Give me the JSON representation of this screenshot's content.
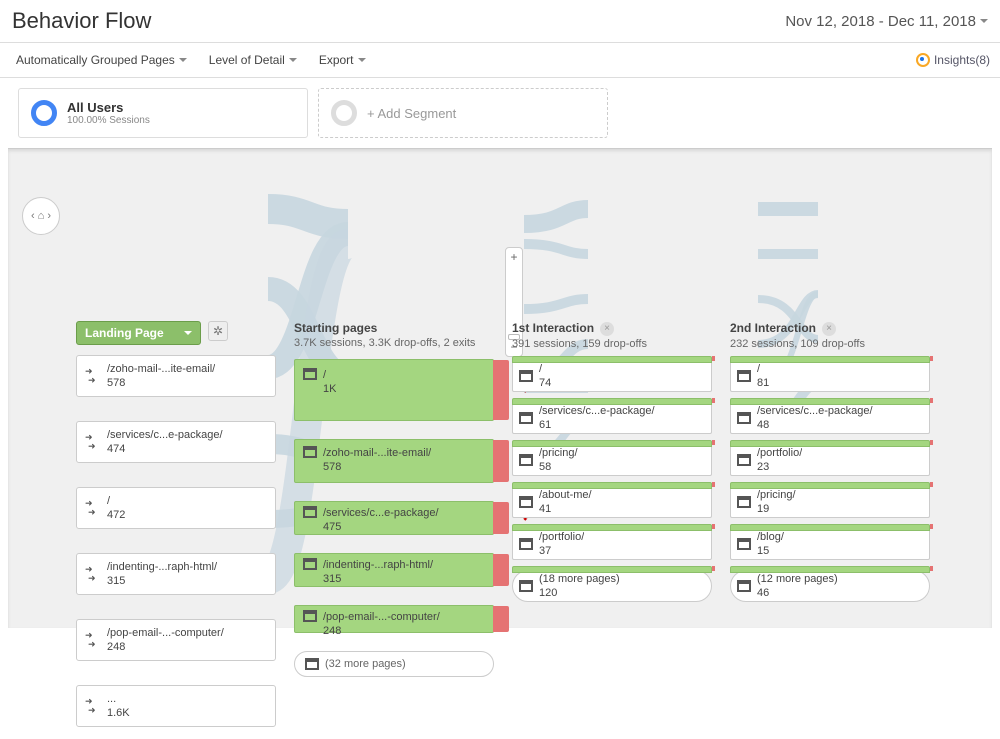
{
  "header": {
    "title": "Behavior Flow",
    "date_range": "Nov 12, 2018 - Dec 11, 2018"
  },
  "toolbar": {
    "grouping": "Automatically Grouped Pages",
    "detail": "Level of Detail",
    "export": "Export",
    "insights": "Insights(8)"
  },
  "segments": {
    "all_users_title": "All Users",
    "all_users_sub": "100.00% Sessions",
    "add_segment": "+ Add Segment"
  },
  "columns": [
    {
      "title": "Landing Page",
      "type": "landing",
      "nodes": [
        {
          "label": "/zoho-mail-...ite-email/",
          "value": "578"
        },
        {
          "label": "/services/c...e-package/",
          "value": "474"
        },
        {
          "label": "/",
          "value": "472"
        },
        {
          "label": "/indenting-...raph-html/",
          "value": "315"
        },
        {
          "label": "/pop-email-...-computer/",
          "value": "248"
        },
        {
          "label": "...",
          "value": "1.6K"
        }
      ]
    },
    {
      "title": "Starting pages",
      "sub": "3.7K sessions, 3.3K drop-offs, 2 exits",
      "type": "start",
      "nodes": [
        {
          "label": "/",
          "value": "1K"
        },
        {
          "label": "/zoho-mail-...ite-email/",
          "value": "578"
        },
        {
          "label": "/services/c...e-package/",
          "value": "475"
        },
        {
          "label": "/indenting-...raph-html/",
          "value": "315"
        },
        {
          "label": "/pop-email-...-computer/",
          "value": "248"
        },
        {
          "label": "(32 more pages)"
        }
      ]
    },
    {
      "title": "1st Interaction",
      "sub": "391 sessions, 159 drop-offs",
      "type": "step",
      "nodes": [
        {
          "label": "/",
          "value": "74"
        },
        {
          "label": "/services/c...e-package/",
          "value": "61"
        },
        {
          "label": "/pricing/",
          "value": "58"
        },
        {
          "label": "/about-me/",
          "value": "41"
        },
        {
          "label": "/portfolio/",
          "value": "37"
        },
        {
          "label": "(18 more pages)",
          "value": "120"
        }
      ]
    },
    {
      "title": "2nd Interaction",
      "sub": "232 sessions, 109 drop-offs",
      "type": "step",
      "nodes": [
        {
          "label": "/",
          "value": "81"
        },
        {
          "label": "/services/c...e-package/",
          "value": "48"
        },
        {
          "label": "/portfolio/",
          "value": "23"
        },
        {
          "label": "/pricing/",
          "value": "19"
        },
        {
          "label": "/blog/",
          "value": "15"
        },
        {
          "label": "(12 more pages)",
          "value": "46"
        }
      ]
    }
  ]
}
